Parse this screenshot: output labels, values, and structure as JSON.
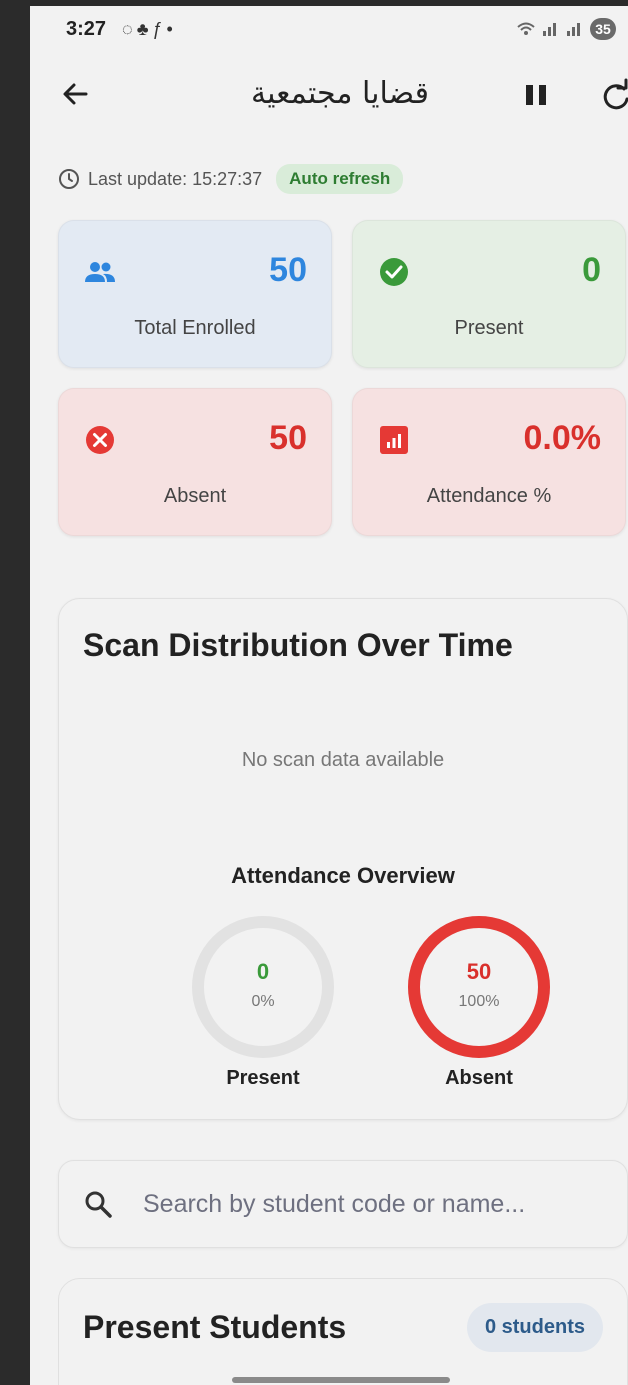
{
  "status_bar": {
    "time": "3:27",
    "left_icons": [
      "whatsapp-icon",
      "snapchat-icon",
      "threads-icon",
      "dot"
    ],
    "battery": "35"
  },
  "app_bar": {
    "title": "قضايا مجتمعية",
    "back_icon": "arrow-left-icon",
    "pause_icon": "pause-icon",
    "refresh_icon": "refresh-icon"
  },
  "update": {
    "text": "Last update: 15:27:37",
    "badge": "Auto refresh"
  },
  "stats": {
    "total": {
      "value": "50",
      "label": "Total Enrolled",
      "color": "#2e86de",
      "bg": "#e3eaf3"
    },
    "present": {
      "value": "0",
      "label": "Present",
      "color": "#3a9a3a",
      "bg": "#e5efe4"
    },
    "absent": {
      "value": "50",
      "label": "Absent",
      "color": "#d9302c",
      "bg": "#f6e1e1"
    },
    "attendance": {
      "value": "0.0%",
      "label": "Attendance %",
      "color": "#d9302c",
      "bg": "#f6e1e1"
    }
  },
  "scan_card": {
    "title": "Scan Distribution Over Time",
    "no_data": "No scan data available"
  },
  "overview": {
    "title": "Attendance Overview",
    "present": {
      "value": "0",
      "pct": "0%",
      "label": "Present",
      "fraction": 0,
      "color": "#3a9a3a"
    },
    "absent": {
      "value": "50",
      "pct": "100%",
      "label": "Absent",
      "fraction": 1,
      "color": "#e53935"
    }
  },
  "search": {
    "placeholder": "Search by student code or name...",
    "value": ""
  },
  "students": {
    "title": "Present Students",
    "badge": "0 students"
  }
}
